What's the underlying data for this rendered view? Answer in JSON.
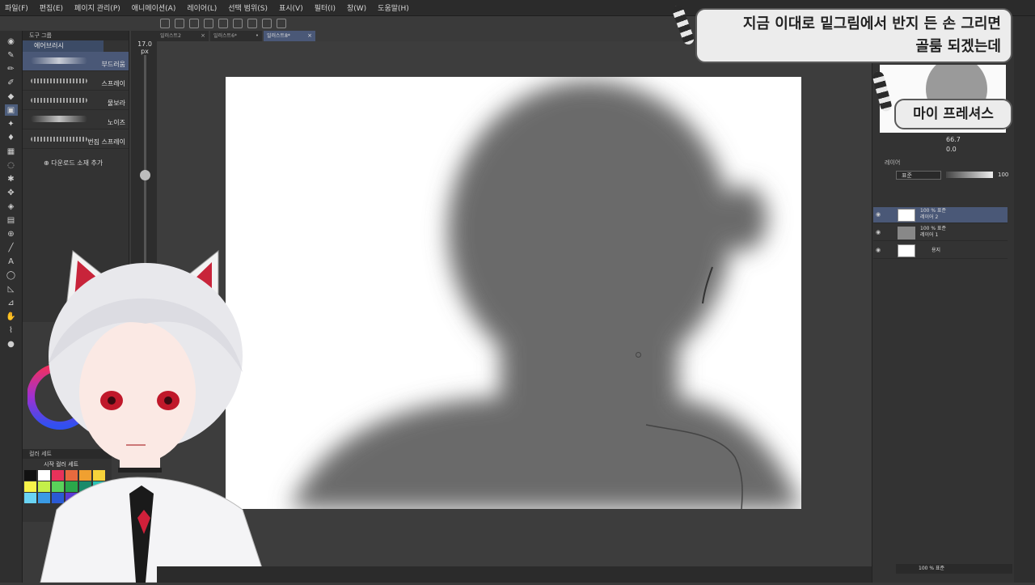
{
  "menu": [
    "파일(F)",
    "편집(E)",
    "페이지 관리(P)",
    "애니메이션(A)",
    "레이어(L)",
    "선택 범위(S)",
    "표시(V)",
    "필터(I)",
    "창(W)",
    "도움말(H)"
  ],
  "subtool": {
    "group_label": "도구 그룹",
    "tab": "에어브러시",
    "brushes": [
      {
        "label": "부드러움"
      },
      {
        "label": "스프레이"
      },
      {
        "label": "물보라"
      },
      {
        "label": "노이즈"
      },
      {
        "label": "번짐 스프레이"
      }
    ],
    "add_material": "다운로드 소재 추가"
  },
  "brush_size": {
    "value": "17.0",
    "unit": "px"
  },
  "doc_tabs": [
    {
      "label": "일러스트2"
    },
    {
      "label": "일러스트6*"
    },
    {
      "label": "일러스트8*"
    }
  ],
  "navigator": {
    "zoom": "66.7",
    "rotation": "0.0"
  },
  "layers_panel": {
    "title": "레이어",
    "blend": "표준",
    "opacity": "100",
    "layers": [
      {
        "line1": "100 % 표준",
        "line2": "레이어 2"
      },
      {
        "line1": "100 % 표준",
        "line2": "레이어 1"
      },
      {
        "line1": "",
        "line2": "용지"
      }
    ],
    "bottom_layer": "100 % 표준"
  },
  "palette": {
    "tab": "컬러 세트",
    "title": "시작 컬러 세트",
    "colors": [
      "#111111",
      "#ffffff",
      "#e8325a",
      "#e86a3e",
      "#f0a030",
      "#f6d23a",
      "#f7f34a",
      "#c4f04a",
      "#5ad25a",
      "#2aa84a",
      "#1a8a6a",
      "#2ac4b4",
      "#6ad4f4",
      "#3a9ae4",
      "#2a5ad4",
      "#5a3ad4",
      "#9a3ad4",
      "#d43ab4"
    ]
  },
  "subtitles": {
    "main_line1": "지금 이대로 밑그림에서 반지 든 손 그리면",
    "main_line2": "골룸 되겠는데",
    "small": "마이 프레셔스"
  }
}
